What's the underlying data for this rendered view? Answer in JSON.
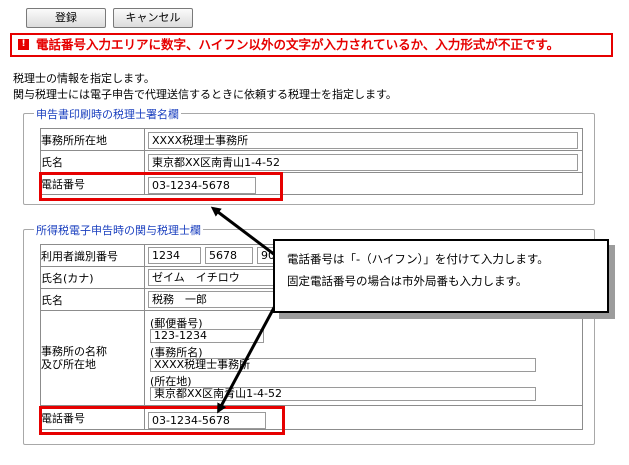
{
  "toolbar": {
    "register_label": "登録",
    "cancel_label": "キャンセル"
  },
  "error": {
    "icon": "!",
    "message": "電話番号入力エリアに数字、ハイフン以外の文字が入力されているか、入力形式が不正です。"
  },
  "description": {
    "line1": "税理士の情報を指定します。",
    "line2": "関与税理士には電子申告で代理送信するときに依頼する税理士を指定します。"
  },
  "section1": {
    "legend": "申告書印刷時の税理士署名欄",
    "office_address_label": "事務所所在地",
    "office_address_value": "XXXX税理士事務所",
    "name_label": "氏名",
    "name_value": "東京都XX区南青山1-4-52",
    "phone_label": "電話番号",
    "phone_value": "03-1234-5678"
  },
  "section2": {
    "legend": "所得税電子申告時の関与税理士欄",
    "user_id_label": "利用者識別番号",
    "user_id_1": "1234",
    "user_id_2": "5678",
    "user_id_3": "90",
    "kana_label": "氏名(カナ)",
    "kana_value": "ゼイム　イチロウ",
    "name_label": "氏名",
    "name_value": "税務　一郎",
    "office_label_1": "事務所の名称",
    "office_label_2": "及び所在地",
    "postal_label": "(郵便番号)",
    "postal_value": "123-1234",
    "office_name_label": "(事務所名)",
    "office_name_value": "XXXX税理士事務所",
    "location_label": "(所在地)",
    "location_value": "東京都XX区南青山1-4-52",
    "phone_label": "電話番号",
    "phone_value": "03-1234-5678"
  },
  "callout": {
    "line1": "電話番号は「-（ハイフン）」を付けて入力します。",
    "line2": "固定電話番号の場合は市外局番も入力します。"
  }
}
